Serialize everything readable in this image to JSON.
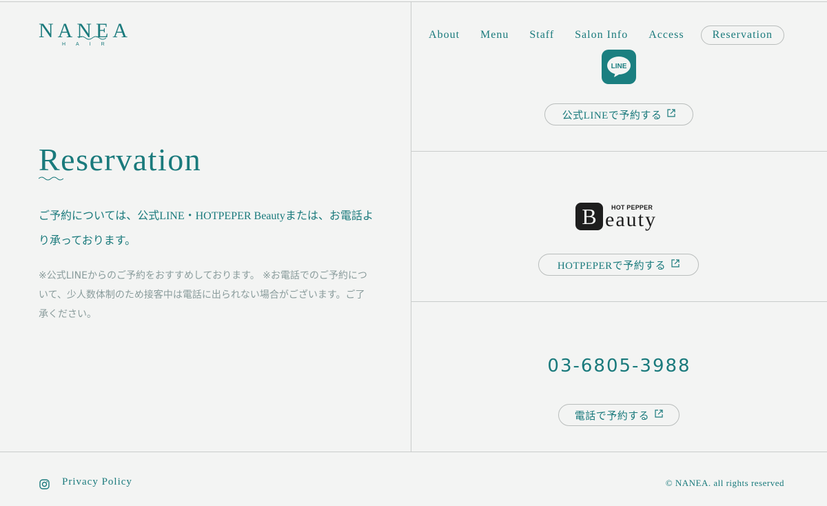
{
  "brand": {
    "name": "NANEA",
    "sub": "HAIR"
  },
  "nav": {
    "items": [
      "About",
      "Menu",
      "Staff",
      "Salon Info",
      "Access"
    ],
    "active": "Reservation"
  },
  "main": {
    "title": "Reservation",
    "lead": "ご予約については、公式LINE・HOTPEPER Beautyまたは、お電話より承っております。",
    "note": "※公式LINEからのご予約をおすすめしております。 ※お電話でのご予約について、少人数体制のため接客中は電話に出られない場合がございます。ご了承ください。"
  },
  "panels": {
    "line": {
      "icon_text": "LINE",
      "button": "公式LINEで予約する"
    },
    "hotpepper": {
      "logo_small": "HOT PEPPER",
      "logo_letter": "B",
      "logo_rest": "eauty",
      "button": "HOTPEPERで予約する"
    },
    "phone": {
      "number": "03-6805-3988",
      "button": "電話で予約する"
    }
  },
  "footer": {
    "privacy": "Privacy Policy",
    "copyright": "© NANEA. all rights reserved"
  },
  "colors": {
    "accent": "#1a7a7c",
    "background": "#f3f4f3",
    "border": "#c9cccb",
    "muted": "#8a9c9c"
  }
}
